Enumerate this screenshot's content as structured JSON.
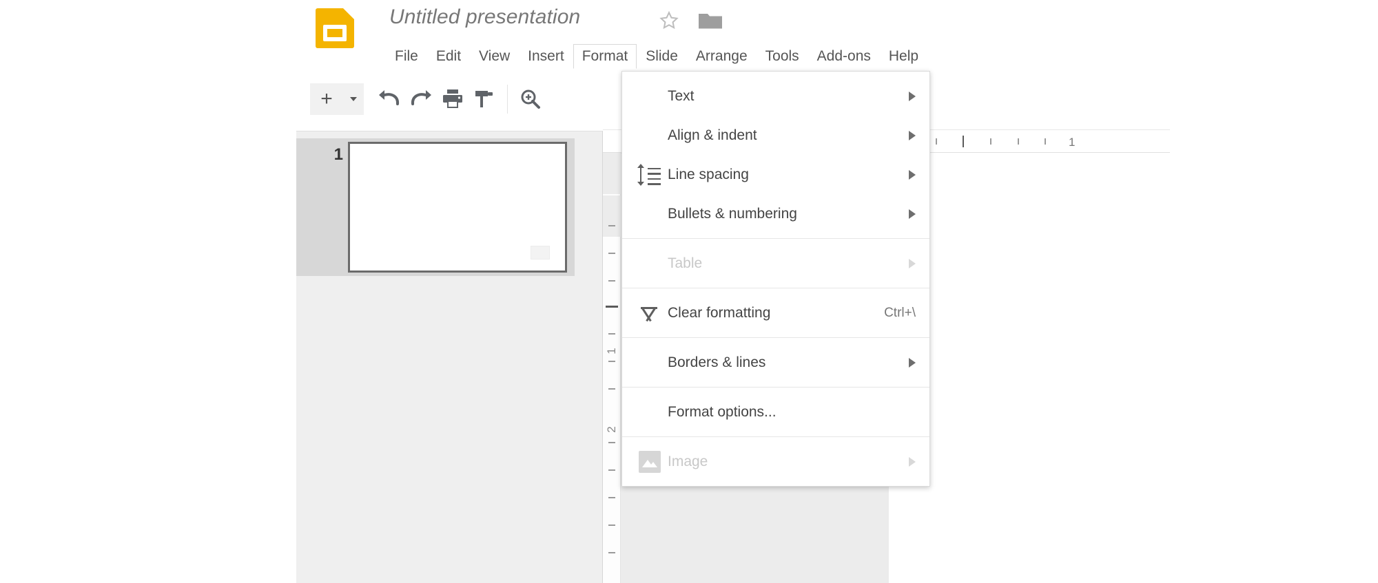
{
  "app": {
    "product": "Google Slides",
    "logo_color": "#F4B400"
  },
  "title_bar": {
    "document_title": "Untitled presentation",
    "star_icon": "star-outline-icon",
    "folder_icon": "folder-icon"
  },
  "menu_bar": {
    "items": [
      {
        "label": "File",
        "open": false
      },
      {
        "label": "Edit",
        "open": false
      },
      {
        "label": "View",
        "open": false
      },
      {
        "label": "Insert",
        "open": false
      },
      {
        "label": "Format",
        "open": true
      },
      {
        "label": "Slide",
        "open": false
      },
      {
        "label": "Arrange",
        "open": false
      },
      {
        "label": "Tools",
        "open": false
      },
      {
        "label": "Add-ons",
        "open": false
      },
      {
        "label": "Help",
        "open": false
      }
    ]
  },
  "toolbar": {
    "buttons": [
      {
        "name": "new-slide-button",
        "icon": "plus-icon"
      },
      {
        "name": "new-slide-dropdown",
        "icon": "chevron-down-icon"
      },
      {
        "name": "undo-button",
        "icon": "undo-icon"
      },
      {
        "name": "redo-button",
        "icon": "redo-icon"
      },
      {
        "name": "print-button",
        "icon": "print-icon"
      },
      {
        "name": "paint-format-button",
        "icon": "paint-format-icon"
      },
      {
        "name": "zoom-button",
        "icon": "zoom-in-icon"
      },
      {
        "name": "fill-color-button",
        "icon": "fill-color-icon"
      },
      {
        "name": "line-color-button",
        "icon": "pencil-icon"
      },
      {
        "name": "line-weight-button",
        "icon": "line-weight-icon"
      },
      {
        "name": "line-dash-button",
        "icon": "line-dash-icon"
      }
    ]
  },
  "format_menu": {
    "groups": [
      {
        "items": [
          {
            "label": "Text",
            "icon": null,
            "arrow": true,
            "accel": "",
            "disabled": false
          },
          {
            "label": "Align & indent",
            "icon": null,
            "arrow": true,
            "accel": "",
            "disabled": false
          },
          {
            "label": "Line spacing",
            "icon": "line-spacing-icon",
            "arrow": true,
            "accel": "",
            "disabled": false
          },
          {
            "label": "Bullets & numbering",
            "icon": null,
            "arrow": true,
            "accel": "",
            "disabled": false
          }
        ]
      },
      {
        "items": [
          {
            "label": "Table",
            "icon": null,
            "arrow": true,
            "accel": "",
            "disabled": true
          }
        ]
      },
      {
        "items": [
          {
            "label": "Clear formatting",
            "icon": "clear-formatting-icon",
            "arrow": false,
            "accel": "Ctrl+\\",
            "disabled": false
          }
        ]
      },
      {
        "items": [
          {
            "label": "Borders & lines",
            "icon": null,
            "arrow": true,
            "accel": "",
            "disabled": false
          }
        ]
      },
      {
        "items": [
          {
            "label": "Format options...",
            "icon": null,
            "arrow": false,
            "accel": "",
            "disabled": false
          }
        ]
      },
      {
        "items": [
          {
            "label": "Image",
            "icon": "image-icon",
            "arrow": true,
            "accel": "",
            "disabled": true
          }
        ]
      }
    ]
  },
  "filmstrip": {
    "slides": [
      {
        "number": "1",
        "selected": true
      }
    ]
  },
  "rulers": {
    "horizontal_labels": [
      "1"
    ],
    "vertical_labels": [
      "1",
      "2"
    ]
  }
}
